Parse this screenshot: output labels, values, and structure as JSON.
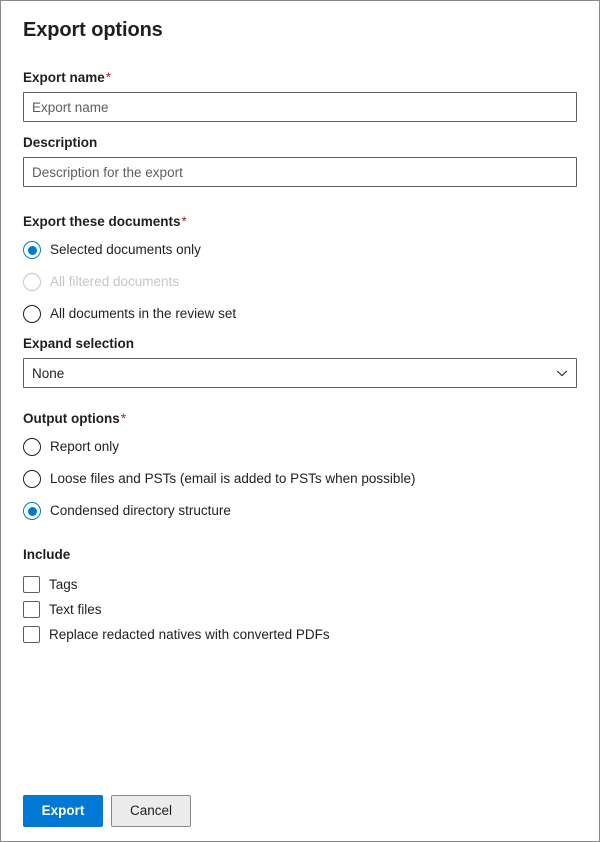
{
  "panel": {
    "title": "Export options"
  },
  "fields": {
    "export_name": {
      "label": "Export name",
      "required_mark": "*",
      "value": "",
      "placeholder": "Export name"
    },
    "description": {
      "label": "Description",
      "value": "",
      "placeholder": "Description for the export"
    }
  },
  "export_documents": {
    "label": "Export these documents",
    "required_mark": "*",
    "options": [
      {
        "label": "Selected documents only",
        "checked": true,
        "disabled": false
      },
      {
        "label": "All filtered documents",
        "checked": false,
        "disabled": true
      },
      {
        "label": "All documents in the review set",
        "checked": false,
        "disabled": false
      }
    ]
  },
  "expand_selection": {
    "label": "Expand selection",
    "selected": "None",
    "chevron_icon": "chevron-down-icon"
  },
  "output_options": {
    "label": "Output options",
    "required_mark": "*",
    "options": [
      {
        "label": "Report only",
        "checked": false
      },
      {
        "label": "Loose files and PSTs (email is added to PSTs when possible)",
        "checked": false
      },
      {
        "label": "Condensed directory structure",
        "checked": true
      }
    ]
  },
  "include": {
    "label": "Include",
    "options": [
      {
        "label": "Tags",
        "checked": false
      },
      {
        "label": "Text files",
        "checked": false
      },
      {
        "label": "Replace redacted natives with converted PDFs",
        "checked": false
      }
    ]
  },
  "footer": {
    "primary_label": "Export",
    "secondary_label": "Cancel"
  },
  "colors": {
    "accent": "#0078d4",
    "required": "#a4262c",
    "text": "#201f1e",
    "disabled": "#c8c6c4",
    "border": "#605e5c"
  }
}
